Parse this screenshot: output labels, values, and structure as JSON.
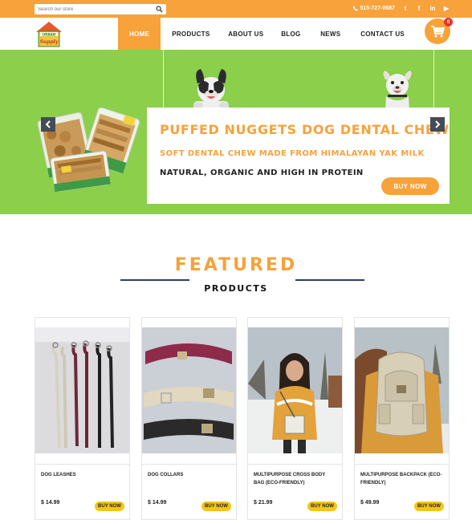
{
  "colors": {
    "accent": "#f7a23a",
    "hero_bg": "#8bcf4a",
    "buy_small": "#f5c518",
    "badge": "#e8322e",
    "divider_line": "#2c3e66"
  },
  "topbar": {
    "search_placeholder": "Search our store",
    "phone": "515-727-0687",
    "social_icons": [
      "twitter-icon",
      "facebook-icon",
      "linkedin-icon",
      "youtube-icon"
    ],
    "social_glyphs": [
      "t",
      "f",
      "in",
      "▶"
    ]
  },
  "header": {
    "logo_text_top": "URBAN",
    "logo_text_bottom": "Supply",
    "nav": [
      "HOME",
      "PRODUCTS",
      "ABOUT US",
      "BLOG",
      "NEWS",
      "CONTACT US"
    ],
    "cart_count": "0"
  },
  "hero": {
    "title": "PUFFED NUGGETS DOG DENTAL CHEW",
    "subtitle": "SOFT DENTAL CHEW MADE FROM HIMALAYAN YAK MILK",
    "tagline": "NATURAL, ORGANIC AND HIGH IN PROTEIN",
    "button": "BUY NOW"
  },
  "featured": {
    "title": "FEATURED",
    "subtitle": "PRODUCTS"
  },
  "products": [
    {
      "name": "DOG LEASHES",
      "price": "$ 14.99",
      "button": "BUY NOW"
    },
    {
      "name": "DOG COLLARS",
      "price": "$ 14.99",
      "button": "BUY NOW"
    },
    {
      "name": "MULTIPURPOSE CROSS BODY BAG (ECO-FRIENDLY)",
      "price": "$ 21.99",
      "button": "BUY NOW"
    },
    {
      "name": "MULTIPURPOSE BACKPACK (ECO-FRIENDLY)",
      "price": "$ 49.99",
      "button": "BUY NOW"
    }
  ]
}
